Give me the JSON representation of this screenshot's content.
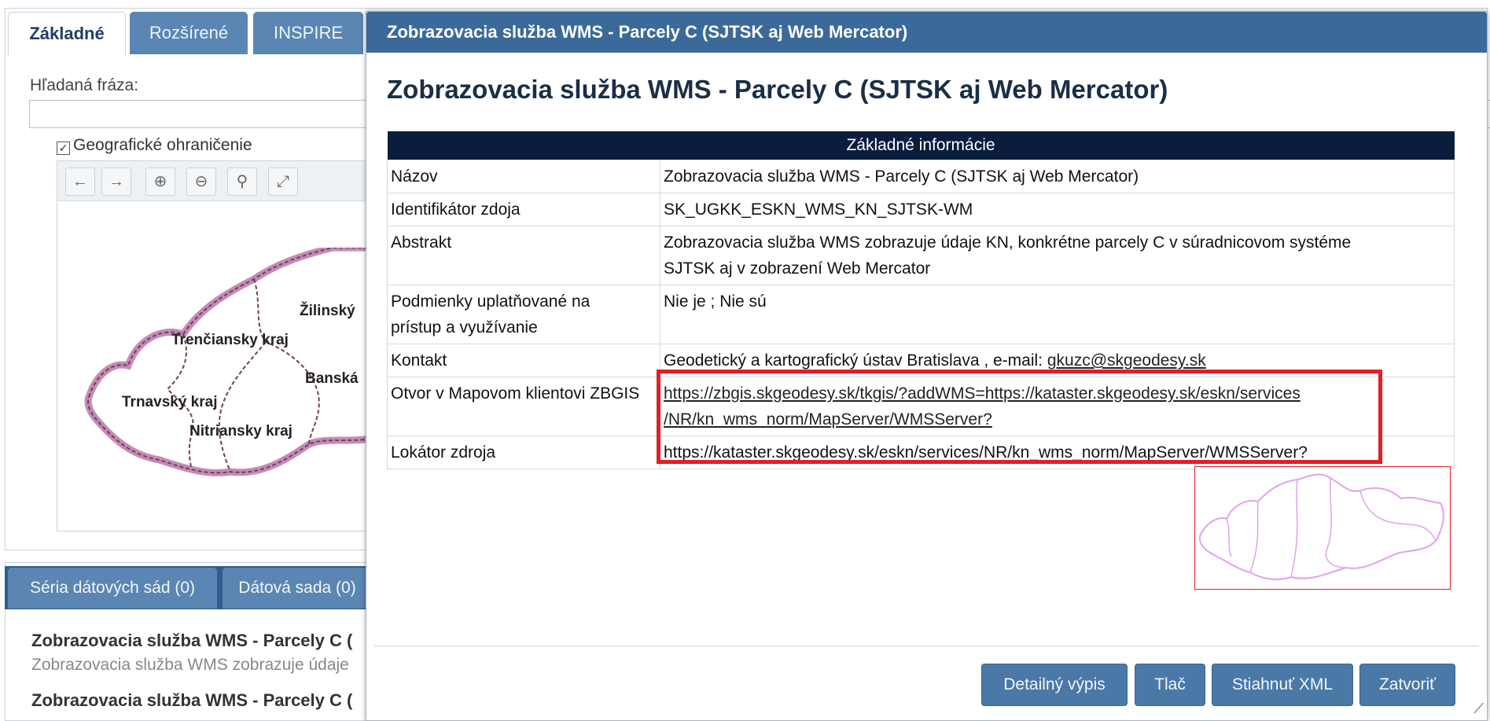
{
  "left_panel": {
    "tabs": [
      "Základné",
      "Rozšírené",
      "INSPIRE"
    ],
    "search_label": "Hľadaná fráza:",
    "search_value": "",
    "geo_checkbox_label": "Geografické ohraničenie",
    "geo_checkbox_checked": true,
    "map_tools": [
      "back-arrow-icon",
      "forward-arrow-icon",
      "zoom-in-icon",
      "zoom-out-icon",
      "zoom-icon",
      "fullscreen-icon"
    ],
    "regions": [
      "Žilinský",
      "Trenčiansky kraj",
      "Banská",
      "Trnavský kraj",
      "Nitriansky kraj"
    ]
  },
  "results_panel": {
    "tabs": [
      "Séria dátových sád (0)",
      "Dátová sada (0)"
    ],
    "items": [
      {
        "title": "Zobrazovacia služba WMS - Parcely C (",
        "desc": "Zobrazovacia služba WMS zobrazuje údaje"
      },
      {
        "title": "Zobrazovacia služba WMS - Parcely C (",
        "desc": ""
      }
    ]
  },
  "dialog": {
    "titlebar": "Zobrazovacia služba WMS - Parcely C (SJTSK aj Web Mercator)",
    "heading": "Zobrazovacia služba WMS - Parcely C (SJTSK aj Web Mercator)",
    "table_header": "Základné informácie",
    "rows": {
      "nazov": {
        "key": "Názov",
        "value": "Zobrazovacia služba WMS - Parcely C (SJTSK aj Web Mercator)"
      },
      "identifikator": {
        "key": "Identifikátor zdoja",
        "value": "SK_UGKK_ESKN_WMS_KN_SJTSK-WM"
      },
      "abstrakt": {
        "key": "Abstrakt",
        "value_line1": "Zobrazovacia služba WMS zobrazuje údaje KN, konkrétne parcely C v súradnicovom systéme",
        "value_line2": "SJTSK aj v zobrazení Web Mercator"
      },
      "podmienky": {
        "key_line1": "Podmienky uplatňované na",
        "key_line2": "prístup a využívanie",
        "value": "Nie je ; Nie sú"
      },
      "kontakt": {
        "key": "Kontakt",
        "value": "Geodetický a kartografický ústav Bratislava , e-mail: ",
        "email": "gkuzc@skgeodesy.sk"
      },
      "otvor": {
        "key": "Otvor v Mapovom klientovi ZBGIS",
        "link_line1": "https://zbgis.skgeodesy.sk/tkgis/?addWMS=https://kataster.skgeodesy.sk/eskn/services",
        "link_line2": "/NR/kn_wms_norm/MapServer/WMSServer?"
      },
      "lokator": {
        "key": "Lokátor zdroja",
        "value": "https://kataster.skgeodesy.sk/eskn/services/NR/kn_wms_norm/MapServer/WMSServer?"
      }
    },
    "buttons": {
      "detail": "Detailný výpis",
      "print": "Tlač",
      "download": "Stiahnuť XML",
      "close": "Zatvoriť"
    },
    "colors": {
      "titlebar": "#3b6a9a",
      "table_header": "#0b1d3d",
      "highlight": "#e31e24",
      "button": "#4a78a7"
    }
  }
}
